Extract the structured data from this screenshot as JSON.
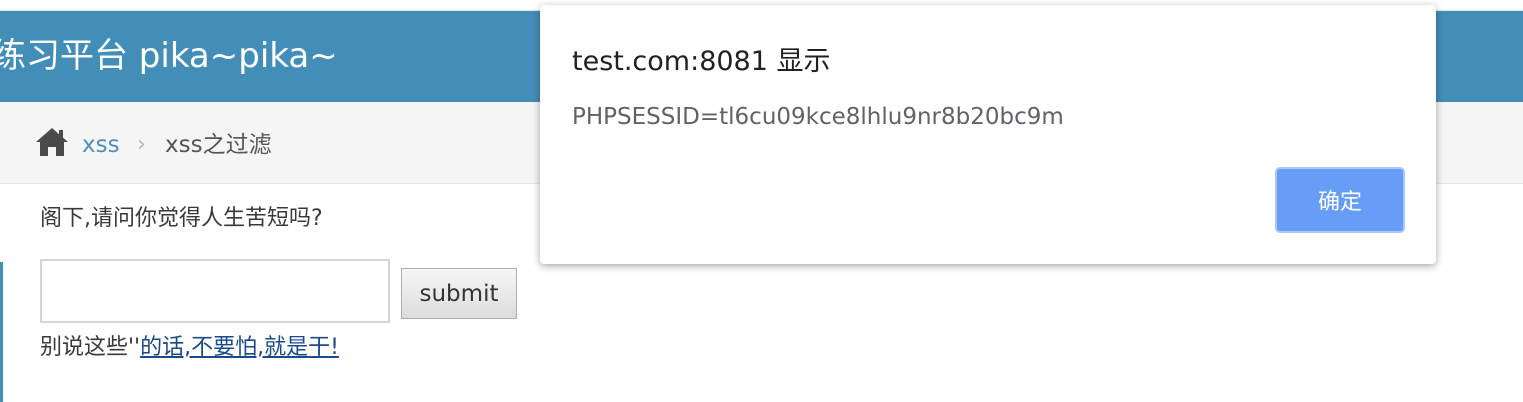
{
  "navbar": {
    "brand": "练习平台 pika~pika~"
  },
  "breadcrumb": {
    "link": "xss",
    "separator": "›",
    "current": "xss之过滤"
  },
  "main": {
    "question": "阁下,请问你觉得人生苦短吗?",
    "input": {
      "value": "",
      "placeholder": ""
    },
    "submit_label": "submit",
    "answer_prefix": "别说这些''",
    "answer_link": "的话,不要怕,就是干!"
  },
  "dialog": {
    "title": "test.com:8081 显示",
    "message": "PHPSESSID=tl6cu09kce8lhlu9nr8b20bc9m",
    "ok_label": "确定"
  },
  "colors": {
    "navbar": "#438eb9",
    "breadcrumb_bg": "#f5f5f5",
    "link": "#4c8fbd",
    "dialog_button": "#669df6"
  }
}
